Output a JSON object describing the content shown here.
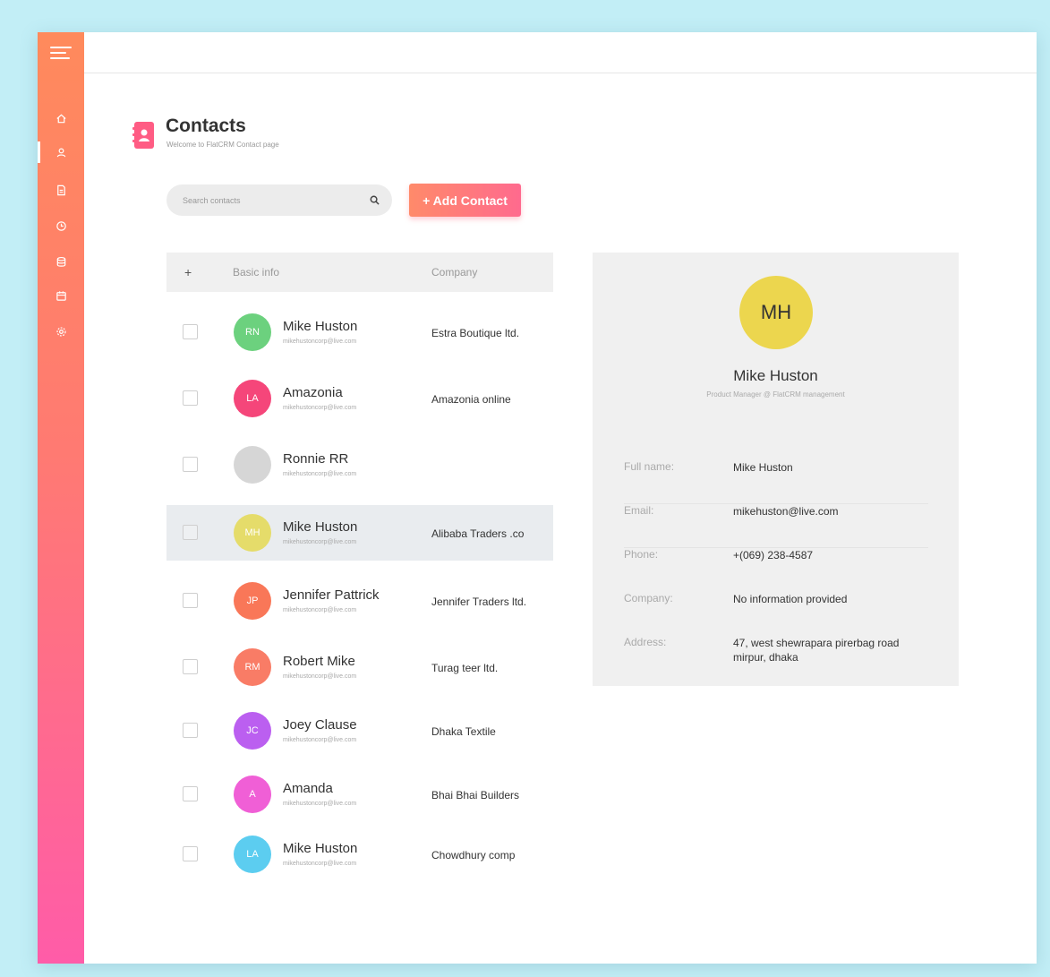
{
  "page": {
    "title": "Contacts",
    "subtitle": "Welcome to FlatCRM Contact page"
  },
  "search": {
    "placeholder": "Search contacts"
  },
  "toolbar": {
    "add_label": "+ Add Contact"
  },
  "table": {
    "header_add": "+",
    "header_basic": "Basic info",
    "header_company": "Company",
    "rows": [
      {
        "initials": "RN",
        "name": "Mike Huston",
        "email": "mikehustoncorp@live.com",
        "company": "Estra Boutique ltd.",
        "color": "#6cd17e",
        "selected": false
      },
      {
        "initials": "LA",
        "name": "Amazonia",
        "email": "mikehustoncorp@live.com",
        "company": "Amazonia online",
        "color": "#f5467a",
        "selected": false
      },
      {
        "initials": "",
        "name": "Ronnie RR",
        "email": "mikehustoncorp@live.com",
        "company": "",
        "color": "#d6d6d6",
        "selected": false
      },
      {
        "initials": "MH",
        "name": "Mike Huston",
        "email": "mikehustoncorp@live.com",
        "company": "Alibaba Traders .co",
        "color": "#e5dc6a",
        "selected": true
      },
      {
        "initials": "JP",
        "name": "Jennifer Pattrick",
        "email": "mikehustoncorp@live.com",
        "company": "Jennifer Traders ltd.",
        "color": "#f97758",
        "selected": false
      },
      {
        "initials": "RM",
        "name": "Robert Mike",
        "email": "mikehustoncorp@live.com",
        "company": "Turag teer ltd.",
        "color": "#f97c66",
        "selected": false
      },
      {
        "initials": "JC",
        "name": "Joey Clause",
        "email": "mikehustoncorp@live.com",
        "company": "Dhaka Textile",
        "color": "#bb5ff0",
        "selected": false
      },
      {
        "initials": "A",
        "name": "Amanda",
        "email": "mikehustoncorp@live.com",
        "company": "Bhai Bhai Builders",
        "color": "#f05fd6",
        "selected": false
      },
      {
        "initials": "LA",
        "name": "Mike Huston",
        "email": "mikehustoncorp@live.com",
        "company": "Chowdhury comp",
        "color": "#5ccdf0",
        "selected": false
      }
    ]
  },
  "detail": {
    "initials": "MH",
    "name": "Mike Huston",
    "role": "Product Manager @ FlatCRM management",
    "fields": [
      {
        "label": "Full name:",
        "value": "Mike Huston"
      },
      {
        "label": "Email:",
        "value": "mikehuston@live.com"
      },
      {
        "label": "Phone:",
        "value": "+(069) 238-4587"
      },
      {
        "label": "Company:",
        "value": "No information provided"
      },
      {
        "label": "Address:",
        "value": "47, west shewrapara pirerbag road mirpur, dhaka"
      }
    ]
  },
  "sidebar": {
    "items": [
      {
        "icon": "home-icon"
      },
      {
        "icon": "user-icon",
        "active": true
      },
      {
        "icon": "document-icon"
      },
      {
        "icon": "clock-icon"
      },
      {
        "icon": "database-icon"
      },
      {
        "icon": "calendar-icon"
      },
      {
        "icon": "gear-icon"
      }
    ]
  },
  "colors": {
    "accent_start": "#ff8a5c",
    "accent_end": "#ff5ca8",
    "selected_row": "#e9ecef",
    "detail_avatar": "#ecd64e"
  }
}
